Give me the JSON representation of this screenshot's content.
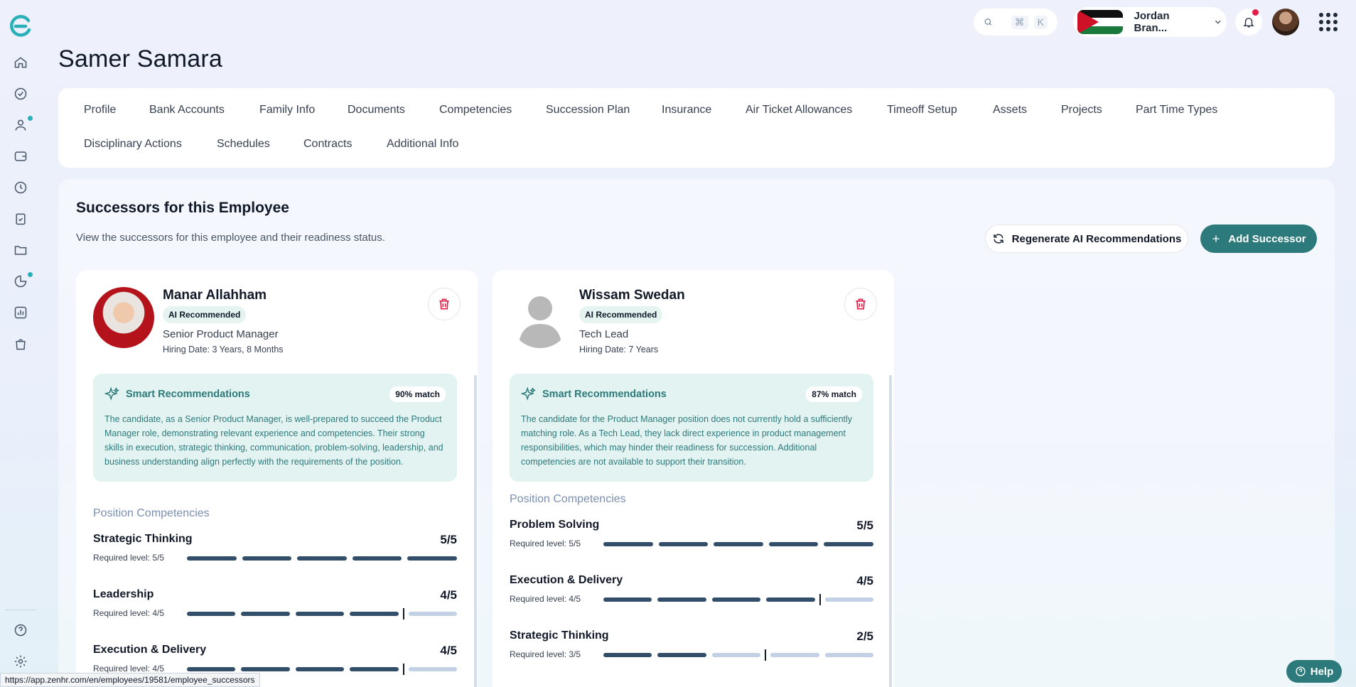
{
  "header": {
    "search_shortcut": [
      "⌘",
      "K"
    ],
    "company_name": "Jordan Bran..."
  },
  "page": {
    "title": "Samer Samara"
  },
  "tabs": [
    "Profile",
    "Bank Accounts",
    "Family Info",
    "Documents",
    "Competencies",
    "Succession Plan",
    "Insurance",
    "Air Ticket Allowances",
    "Timeoff Setup",
    "Assets",
    "Projects",
    "Part Time Types",
    "Disciplinary Actions",
    "Schedules",
    "Contracts",
    "Additional Info"
  ],
  "section": {
    "title": "Successors for this Employee",
    "subtitle": "View the successors for this employee and their readiness status.",
    "regen_label": "Regenerate AI Recommendations",
    "add_label": "Add Successor"
  },
  "successors": [
    {
      "name": "Manar Allahham",
      "badge": "AI Recommended",
      "role": "Senior Product Manager",
      "hiring": "Hiring Date: 3 Years, 8 Months",
      "smart_title": "Smart Recommendations",
      "match": "90% match",
      "smart_text": "The candidate, as a Senior Product Manager, is well-prepared to succeed the Product Manager role, demonstrating relevant experience and competencies. Their strong skills in execution, strategic thinking, communication, problem-solving, leadership, and business understanding align perfectly with the requirements of the position.",
      "comp_heading": "Position Competencies",
      "competencies": [
        {
          "name": "Strategic Thinking",
          "score": "5/5",
          "required": "Required level: 5/5",
          "level": 5,
          "req": 5
        },
        {
          "name": "Leadership",
          "score": "4/5",
          "required": "Required level: 4/5",
          "level": 4,
          "req": 4
        },
        {
          "name": "Execution & Delivery",
          "score": "4/5",
          "required": "Required level: 4/5",
          "level": 4,
          "req": 4
        }
      ]
    },
    {
      "name": "Wissam Swedan",
      "badge": "AI Recommended",
      "role": "Tech Lead",
      "hiring": "Hiring Date: 7 Years",
      "smart_title": "Smart Recommendations",
      "match": "87% match",
      "smart_text": "The candidate for the Product Manager position does not currently hold a sufficiently matching role. As a Tech Lead, they lack direct experience in product management responsibilities, which may hinder their readiness for succession. Additional competencies are not available to support their transition.",
      "comp_heading": "Position Competencies",
      "competencies": [
        {
          "name": "Problem Solving",
          "score": "5/5",
          "required": "Required level: 5/5",
          "level": 5,
          "req": 5
        },
        {
          "name": "Execution & Delivery",
          "score": "4/5",
          "required": "Required level: 4/5",
          "level": 4,
          "req": 4
        },
        {
          "name": "Strategic Thinking",
          "score": "2/5",
          "required": "Required level: 3/5",
          "level": 2,
          "req": 3
        }
      ]
    }
  ],
  "status_url": "https://app.zenhr.com/en/employees/19581/employee_successors",
  "help_label": "Help",
  "colors": {
    "accent": "#2c7a7b",
    "bar_filled": "#334e68",
    "bar_empty": "#c3d1e6",
    "danger": "#e11d48"
  }
}
